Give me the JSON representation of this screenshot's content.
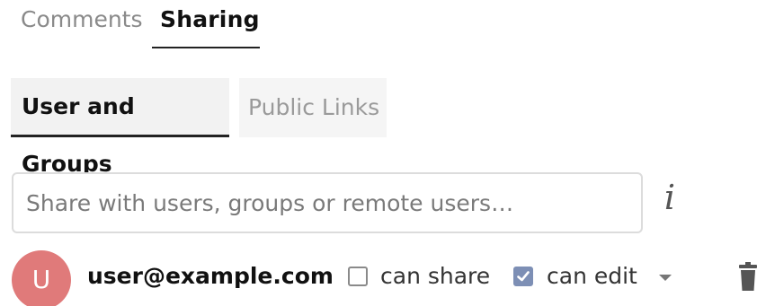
{
  "top_tabs": {
    "comments": "Comments",
    "sharing": "Sharing",
    "active": "Sharing"
  },
  "sub_tabs": {
    "users_and_groups": "User and Groups",
    "public_links": "Public Links",
    "active": "User and Groups"
  },
  "share_input": {
    "value": "",
    "placeholder": "Share with users, groups or remote users…"
  },
  "info_icon": {
    "glyph": "i",
    "name": "info-icon"
  },
  "share_entry": {
    "avatar_initial": "U",
    "avatar_color": "#e07a7a",
    "email": "user@example.com",
    "permissions": {
      "can_share": {
        "label": "can share",
        "checked": false
      },
      "can_edit": {
        "label": "can edit",
        "checked": true
      }
    }
  },
  "colors": {
    "checkbox_checked": "#7d8fb5",
    "active_tab_text": "#111111",
    "inactive_tab_text": "#8a8a8a"
  }
}
